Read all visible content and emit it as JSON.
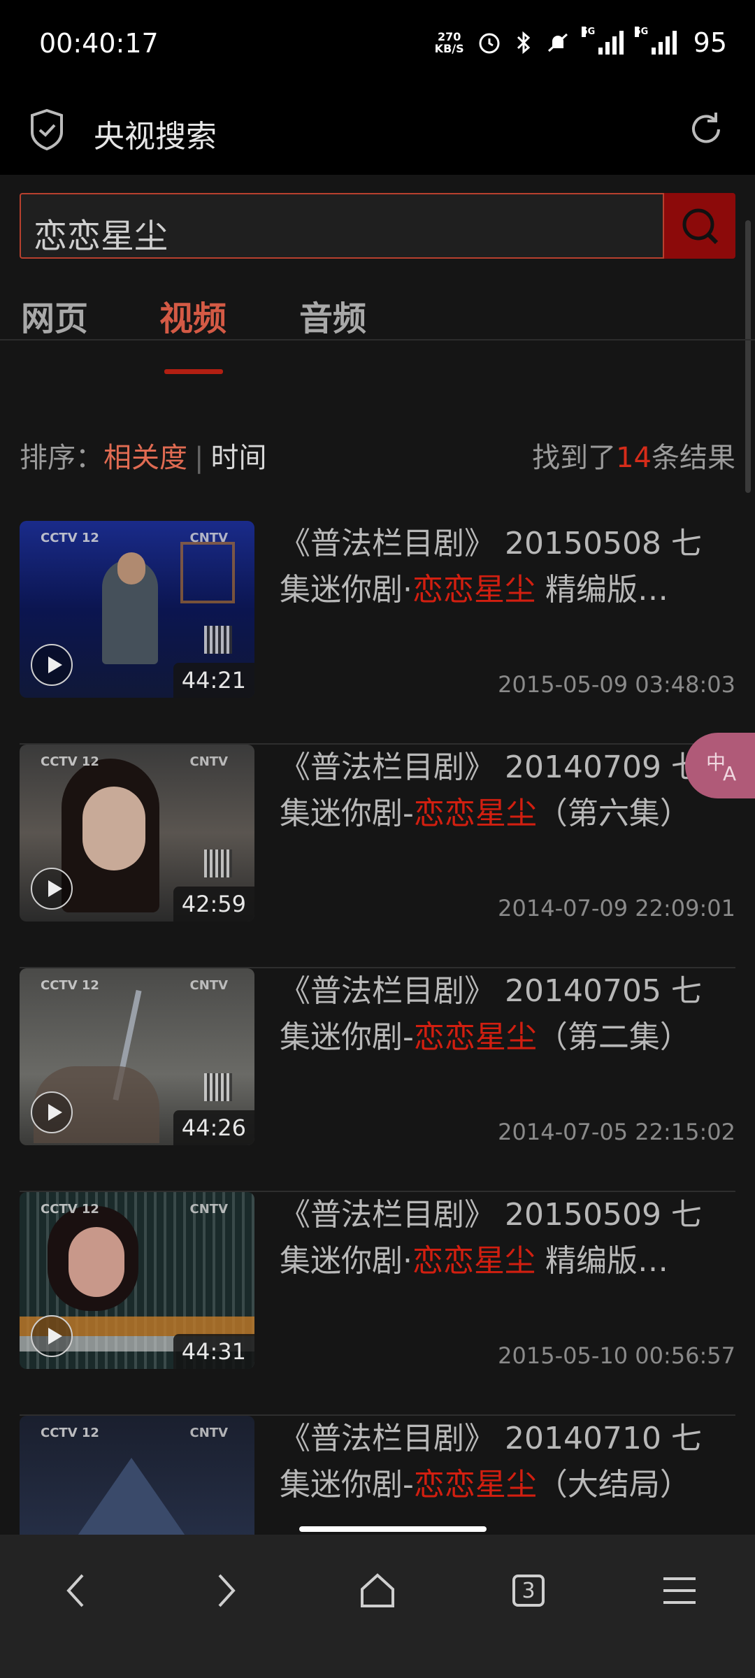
{
  "status": {
    "time": "00:40:17",
    "net_speed_top": "270",
    "net_speed_bottom": "KB/S",
    "network_1": "5G",
    "network_2": "5G",
    "battery": "95"
  },
  "appbar": {
    "title": "央视搜索"
  },
  "search": {
    "query": "恋恋星尘"
  },
  "tabs": [
    {
      "label": "网页"
    },
    {
      "label": "视频"
    },
    {
      "label": "音频"
    }
  ],
  "active_tab": "视频",
  "sort": {
    "label": "排序：",
    "relevance": "相关度",
    "separator": "|",
    "time": "时间"
  },
  "results_count": {
    "prefix": "找到了",
    "count": "14",
    "suffix": "条结果"
  },
  "results": [
    {
      "title_pre": "《普法栏目剧》 20150508 七集迷你剧·",
      "title_hl": "恋恋星尘",
      "title_post": " 精编版…",
      "duration": "44:21",
      "date": "2015-05-09 03:48:03"
    },
    {
      "title_pre": "《普法栏目剧》 20140709 七集迷你剧-",
      "title_hl": "恋恋星尘",
      "title_post": "（第六集）",
      "duration": "42:59",
      "date": "2014-07-09 22:09:01"
    },
    {
      "title_pre": "《普法栏目剧》 20140705 七集迷你剧-",
      "title_hl": "恋恋星尘",
      "title_post": "（第二集）",
      "duration": "44:26",
      "date": "2014-07-05 22:15:02"
    },
    {
      "title_pre": "《普法栏目剧》 20150509 七集迷你剧·",
      "title_hl": "恋恋星尘",
      "title_post": " 精编版…",
      "duration": "44:31",
      "date": "2015-05-10 00:56:57"
    },
    {
      "title_pre": "《普法栏目剧》 20140710 七集迷你剧-",
      "title_hl": "恋恋星尘",
      "title_post": "（大结局）",
      "duration": "",
      "date": ""
    }
  ],
  "thumb_labels": {
    "left": "CCTV 12",
    "right": "CNTV"
  },
  "bottom_nav": {
    "tab_count": "3"
  },
  "icons": [
    "shield-check-icon",
    "refresh-icon",
    "search-icon",
    "play-icon",
    "translate-icon",
    "back-icon",
    "forward-icon",
    "home-icon",
    "tabs-icon",
    "menu-icon"
  ],
  "colors": {
    "accent": "#d21f10",
    "search_button": "#8c0a0a",
    "active_tab": "#d45a45"
  }
}
